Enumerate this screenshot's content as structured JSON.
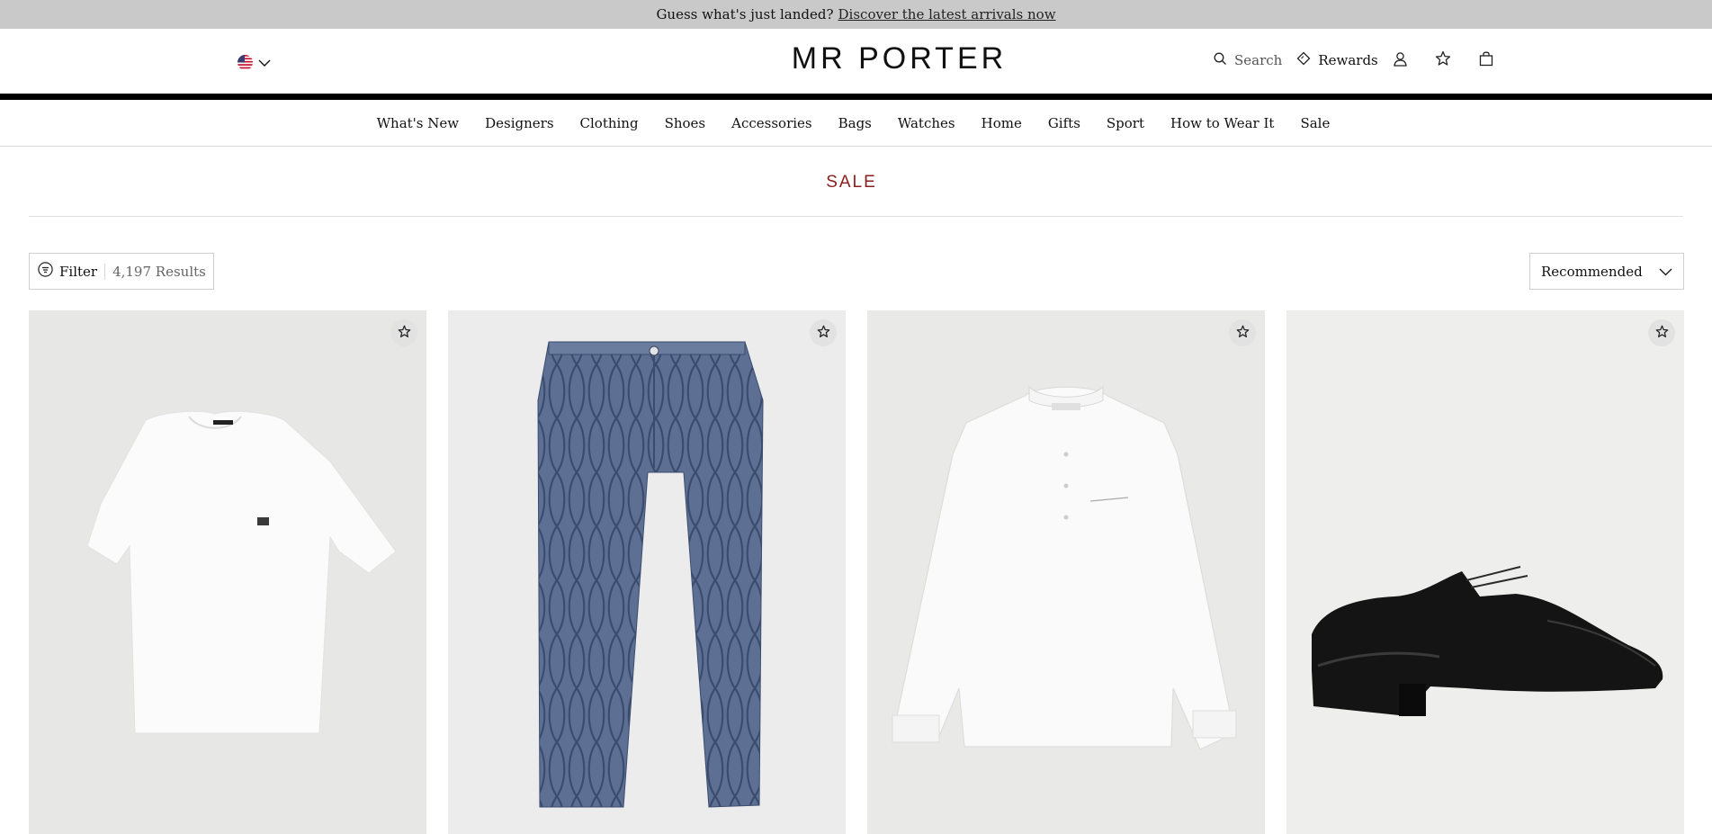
{
  "announcement": {
    "text": "Guess what's just landed?",
    "link": "Discover the latest arrivals now"
  },
  "header": {
    "logo": "MR PORTER",
    "locale_icon": "us-flag-icon",
    "search_label": "Search",
    "rewards_label": "Rewards",
    "icons": [
      "search-icon",
      "rewards-diamond-icon",
      "account-icon",
      "wishlist-star-icon",
      "bag-icon"
    ]
  },
  "nav": {
    "items": [
      {
        "label": "What's New"
      },
      {
        "label": "Designers"
      },
      {
        "label": "Clothing"
      },
      {
        "label": "Shoes"
      },
      {
        "label": "Accessories"
      },
      {
        "label": "Bags"
      },
      {
        "label": "Watches"
      },
      {
        "label": "Home"
      },
      {
        "label": "Gifts"
      },
      {
        "label": "Sport"
      },
      {
        "label": "How to Wear It"
      },
      {
        "label": "Sale"
      }
    ]
  },
  "page": {
    "title": "SALE",
    "title_color": "#8a1f1f"
  },
  "toolbar": {
    "filter_label": "Filter",
    "results": "4,197 Results",
    "sort_value": "Recommended"
  },
  "products": [
    {
      "image": "white-t-shirt"
    },
    {
      "image": "blue-patterned-trousers"
    },
    {
      "image": "white-grandad-collar-shirt"
    },
    {
      "image": "black-oxford-shoes"
    }
  ]
}
